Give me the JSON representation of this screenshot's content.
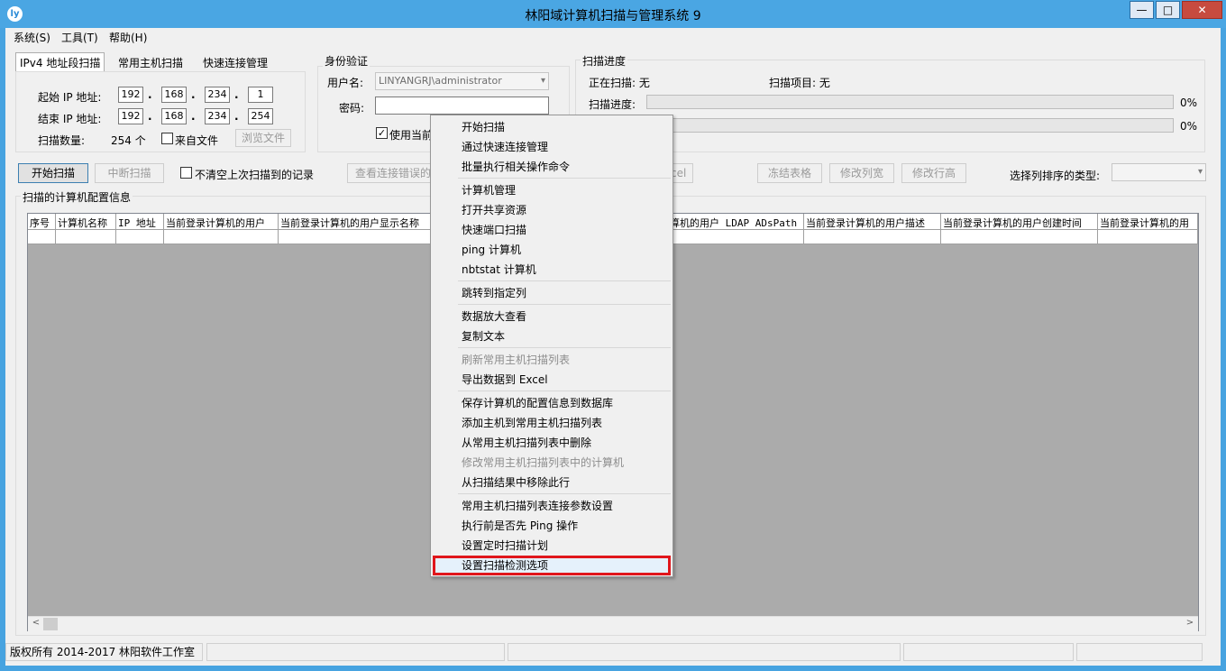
{
  "window": {
    "title": "林阳域计算机扫描与管理系统 9",
    "icon": "app-logo-icon",
    "min_label": "—",
    "max_label": "□",
    "close_label": "✕"
  },
  "menu": [
    "系统(S)",
    "工具(T)",
    "帮助(H)"
  ],
  "tabs": [
    "IPv4 地址段扫描",
    "常用主机扫描",
    "快速连接管理"
  ],
  "ipv4": {
    "start_label": "起始 IP 地址:",
    "start": [
      "192",
      "168",
      "234",
      "1"
    ],
    "end_label": "结束 IP 地址:",
    "end": [
      "192",
      "168",
      "234",
      "254"
    ],
    "count_label": "扫描数量:",
    "count_value": "254 个",
    "from_file_label": "来自文件",
    "browse_label": "浏览文件"
  },
  "auth": {
    "group_label": "身份验证",
    "user_label": "用户名:",
    "user_value": "LINYANGRJ\\administrator",
    "password_label": "密码:",
    "use_current_label": "使用当前"
  },
  "progress": {
    "group_label": "扫描进度",
    "scanning_label": "正在扫描: 无",
    "item_label": "扫描项目: 无",
    "progress_label": "扫描进度:",
    "pct1": "0%",
    "pct2": "0%",
    "value1": 0,
    "value2": 0
  },
  "toolbar": {
    "start": "开始扫描",
    "stop": "中断扫描",
    "keep_label": "不清空上次扫描到的记录",
    "view_errors": "查看连接错误的",
    "excel_partial": "cel",
    "freeze": "冻结表格",
    "col_width": "修改列宽",
    "row_height": "修改行高",
    "sort_label": "选择列排序的类型:"
  },
  "grid": {
    "group_label": "扫描的计算机配置信息",
    "columns_left": [
      "序号",
      "计算机名称",
      "IP 地址",
      "当前登录计算机的用户",
      "当前登录计算机的用户显示名称"
    ],
    "columns_right": [
      "算机的用户 LDAP ADsPath",
      "当前登录计算机的用户描述",
      "当前登录计算机的用户创建时间",
      "当前登录计算机的用"
    ],
    "scroll_left": "<",
    "scroll_right": ">"
  },
  "status": {
    "copyright": "版权所有 2014-2017 林阳软件工作室"
  },
  "context_menu": {
    "groups": [
      [
        {
          "label": "开始扫描"
        },
        {
          "label": "通过快速连接管理"
        },
        {
          "label": "批量执行相关操作命令"
        }
      ],
      [
        {
          "label": "计算机管理"
        },
        {
          "label": "打开共享资源"
        },
        {
          "label": "快速端口扫描"
        },
        {
          "label": "ping 计算机"
        },
        {
          "label": "nbtstat 计算机"
        }
      ],
      [
        {
          "label": "跳转到指定列"
        }
      ],
      [
        {
          "label": "数据放大查看"
        },
        {
          "label": "复制文本"
        }
      ],
      [
        {
          "label": "刷新常用主机扫描列表",
          "disabled": true
        },
        {
          "label": "导出数据到 Excel"
        }
      ],
      [
        {
          "label": "保存计算机的配置信息到数据库"
        },
        {
          "label": "添加主机到常用主机扫描列表"
        },
        {
          "label": "从常用主机扫描列表中删除"
        },
        {
          "label": "修改常用主机扫描列表中的计算机",
          "disabled": true
        },
        {
          "label": "从扫描结果中移除此行"
        }
      ],
      [
        {
          "label": "常用主机扫描列表连接参数设置"
        },
        {
          "label": "执行前是否先 Ping 操作"
        },
        {
          "label": "设置定时扫描计划"
        },
        {
          "label": "设置扫描检测选项",
          "highlight": true
        }
      ]
    ]
  },
  "colors": {
    "title_bar": "#4aa6e3",
    "highlight_border": "#e0161b",
    "highlight_fill": "#e5f1fb"
  }
}
